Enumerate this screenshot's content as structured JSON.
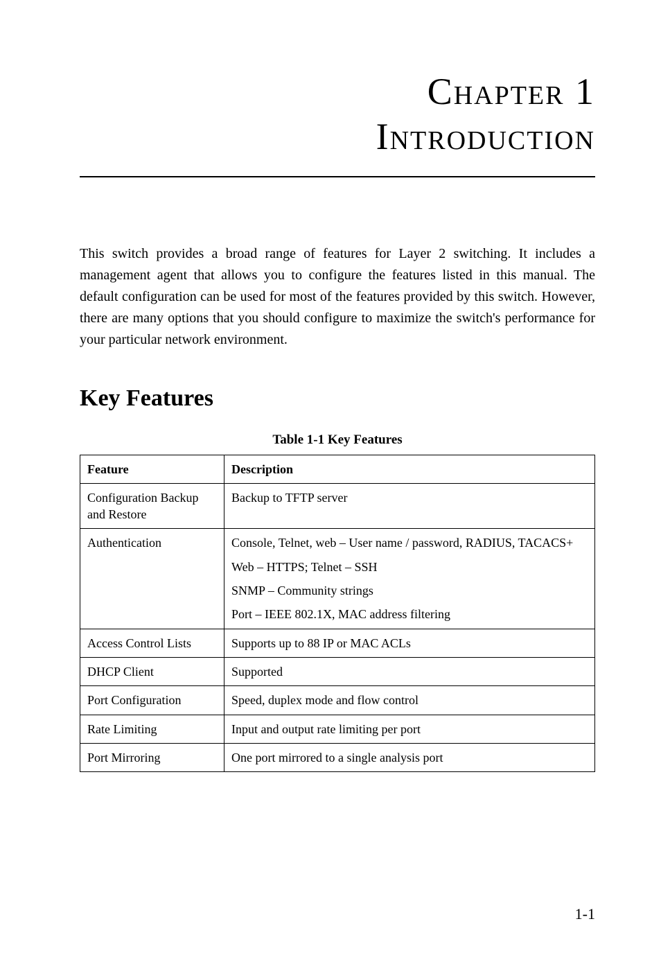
{
  "header": {
    "chapter_label": "Chapter 1",
    "chapter_title": "Introduction"
  },
  "intro": {
    "paragraph": "This switch provides a broad range of features for Layer 2 switching. It includes a management agent that allows you to configure the features listed in this manual. The default configuration can be used for most of the features provided by this switch. However, there are many options that you should configure to maximize the switch's performance for your particular network environment."
  },
  "section": {
    "heading": "Key Features"
  },
  "table": {
    "caption": "Table 1-1  Key Features",
    "columns": {
      "feature": "Feature",
      "description": "Description"
    },
    "rows": [
      {
        "feature": "Configuration Backup and Restore",
        "description": "Backup to TFTP server"
      },
      {
        "feature": "Authentication",
        "description_lines": [
          "Console, Telnet, web – User name / password, RADIUS, TACACS+",
          "Web – HTTPS; Telnet – SSH",
          "SNMP – Community strings",
          "Port – IEEE 802.1X, MAC address filtering"
        ]
      },
      {
        "feature": "Access Control Lists",
        "description": "Supports up to 88 IP or MAC ACLs"
      },
      {
        "feature": "DHCP Client",
        "description": "Supported"
      },
      {
        "feature": "Port Configuration",
        "description": "Speed, duplex mode and flow control"
      },
      {
        "feature": "Rate Limiting",
        "description": "Input and output rate limiting per port"
      },
      {
        "feature": "Port Mirroring",
        "description": "One port mirrored to a single analysis port"
      }
    ]
  },
  "footer": {
    "page_number": "1-1"
  }
}
